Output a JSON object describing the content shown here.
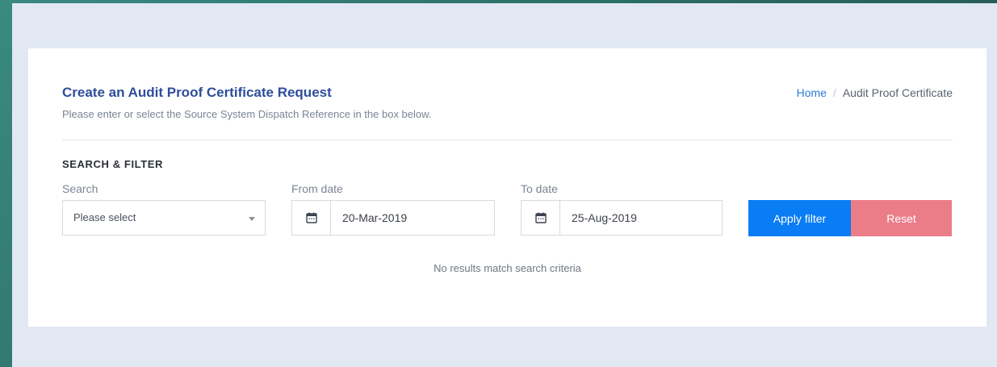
{
  "header": {
    "title": "Create an Audit Proof Certificate Request",
    "subtitle": "Please enter or select the Source System Dispatch Reference in the box below."
  },
  "breadcrumb": {
    "home": "Home",
    "separator": "/",
    "current": "Audit Proof Certificate"
  },
  "filter": {
    "section_title": "SEARCH & FILTER",
    "search": {
      "label": "Search",
      "selected": "Please select"
    },
    "from_date": {
      "label": "From date",
      "value": "20-Mar-2019"
    },
    "to_date": {
      "label": "To date",
      "value": "25-Aug-2019"
    },
    "apply_label": "Apply filter",
    "reset_label": "Reset"
  },
  "results": {
    "empty_message": "No results match search criteria"
  },
  "icons": {
    "calendar": "calendar-icon",
    "dropdown": "chevron-down-icon"
  },
  "colors": {
    "title": "#2e4d9b",
    "link": "#2d7ad7",
    "apply_button": "#0a7cf4",
    "reset_button": "#ea7d88",
    "frame_background": "#e1e8f4"
  }
}
